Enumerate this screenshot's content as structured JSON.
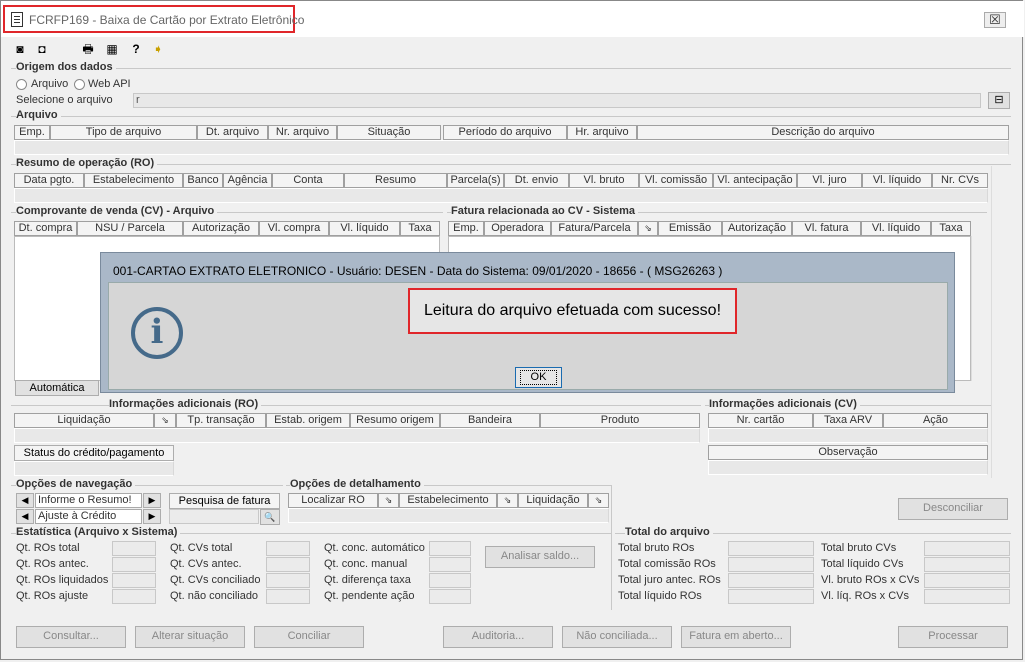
{
  "window": {
    "title": "FCRFP169 - Baixa de Cartão por Extrato Eletrônico",
    "close": "☒"
  },
  "toolbar": {
    "icons": [
      "◙",
      "◘",
      "🖶",
      "▦",
      "?",
      "➧"
    ]
  },
  "origem": {
    "title": "Origem dos dados",
    "opt_arquivo": "Arquivo",
    "opt_webapi": "Web API",
    "select_label": "Selecione o arquivo",
    "path_value": "r",
    "browse": "⊟"
  },
  "arquivo": {
    "title": "Arquivo",
    "cols": [
      "Emp.",
      "Tipo de arquivo",
      "Dt. arquivo",
      "Nr. arquivo",
      "Situação",
      "Período do arquivo",
      "Hr. arquivo",
      "Descrição do arquivo"
    ]
  },
  "ro": {
    "title": "Resumo de operação (RO)",
    "cols": [
      "Data pgto.",
      "Estabelecimento",
      "Banco",
      "Agência",
      "Conta",
      "Resumo",
      "Parcela(s)",
      "Dt. envio",
      "Vl. bruto",
      "Vl. comissão",
      "Vl. antecipação",
      "Vl. juro",
      "Vl. líquido",
      "Nr. CVs"
    ]
  },
  "cv": {
    "title": "Comprovante de venda (CV) - Arquivo",
    "cols": [
      "Dt. compra",
      "NSU / Parcela",
      "Autorização",
      "Vl. compra",
      "Vl. líquido",
      "Taxa"
    ],
    "automatica": "Automática"
  },
  "fatura": {
    "title": "Fatura relacionada ao CV - Sistema",
    "cols": [
      "Emp.",
      "Operadora",
      "Fatura/Parcela",
      "⇘",
      "Emissão",
      "Autorização",
      "Vl. fatura",
      "Vl. líquido",
      "Taxa"
    ]
  },
  "dialog": {
    "title": "001-CARTAO EXTRATO ELETRONICO - Usuário: DESEN - Data do Sistema: 09/01/2020 - 18656 - ( MSG26263 )",
    "icon": "i",
    "message": "Leitura do arquivo efetuada com sucesso!",
    "ok": "OK"
  },
  "info_ro": {
    "title": "Informações adicionais (RO)",
    "cols": [
      "Liquidação",
      "⇘",
      "Tp. transação",
      "Estab. origem",
      "Resumo origem",
      "Bandeira",
      "Produto"
    ],
    "status_btn": "Status do crédito/pagamento"
  },
  "info_cv": {
    "title": "Informações adicionais (CV)",
    "cols": [
      "Nr. cartão",
      "Taxa ARV",
      "Ação"
    ],
    "obs": "Observação"
  },
  "nav": {
    "title": "Opções de navegação",
    "informe": "Informe o Resumo!",
    "ajuste": "Ajuste à Crédito",
    "pesquisa": "Pesquisa de fatura",
    "search_icon": "🔍",
    "left": "◀",
    "right": "▶"
  },
  "det": {
    "title": "Opções de detalhamento",
    "localizar": "Localizar RO",
    "estab": "Estabelecimento",
    "liquid": "Liquidação",
    "arrow": "⇘"
  },
  "desconciliar": "Desconciliar",
  "estat": {
    "title": "Estatística (Arquivo x Sistema)",
    "col1": [
      "Qt. ROs total",
      "Qt. ROs antec.",
      "Qt. ROs liquidados",
      "Qt. ROs ajuste"
    ],
    "col2": [
      "Qt. CVs total",
      "Qt. CVs antec.",
      "Qt. CVs conciliado",
      "Qt. não conciliado"
    ],
    "col3": [
      "Qt. conc. automático",
      "Qt. conc. manual",
      "Qt. diferença taxa",
      "Qt. pendente ação"
    ],
    "analisar": "Analisar saldo..."
  },
  "total": {
    "title": "Total do arquivo",
    "col1": [
      "Total bruto ROs",
      "Total comissão ROs",
      "Total juro antec. ROs",
      "Total líquido ROs"
    ],
    "col2": [
      "Total bruto CVs",
      "Total líquido CVs",
      "Vl. bruto ROs x CVs",
      "Vl. líq. ROs x CVs"
    ]
  },
  "buttons": {
    "consultar": "Consultar...",
    "alterar": "Alterar situação",
    "conciliar": "Conciliar",
    "auditoria": "Auditoria...",
    "nao_conc": "Não conciliada...",
    "fatura": "Fatura em aberto...",
    "processar": "Processar"
  }
}
